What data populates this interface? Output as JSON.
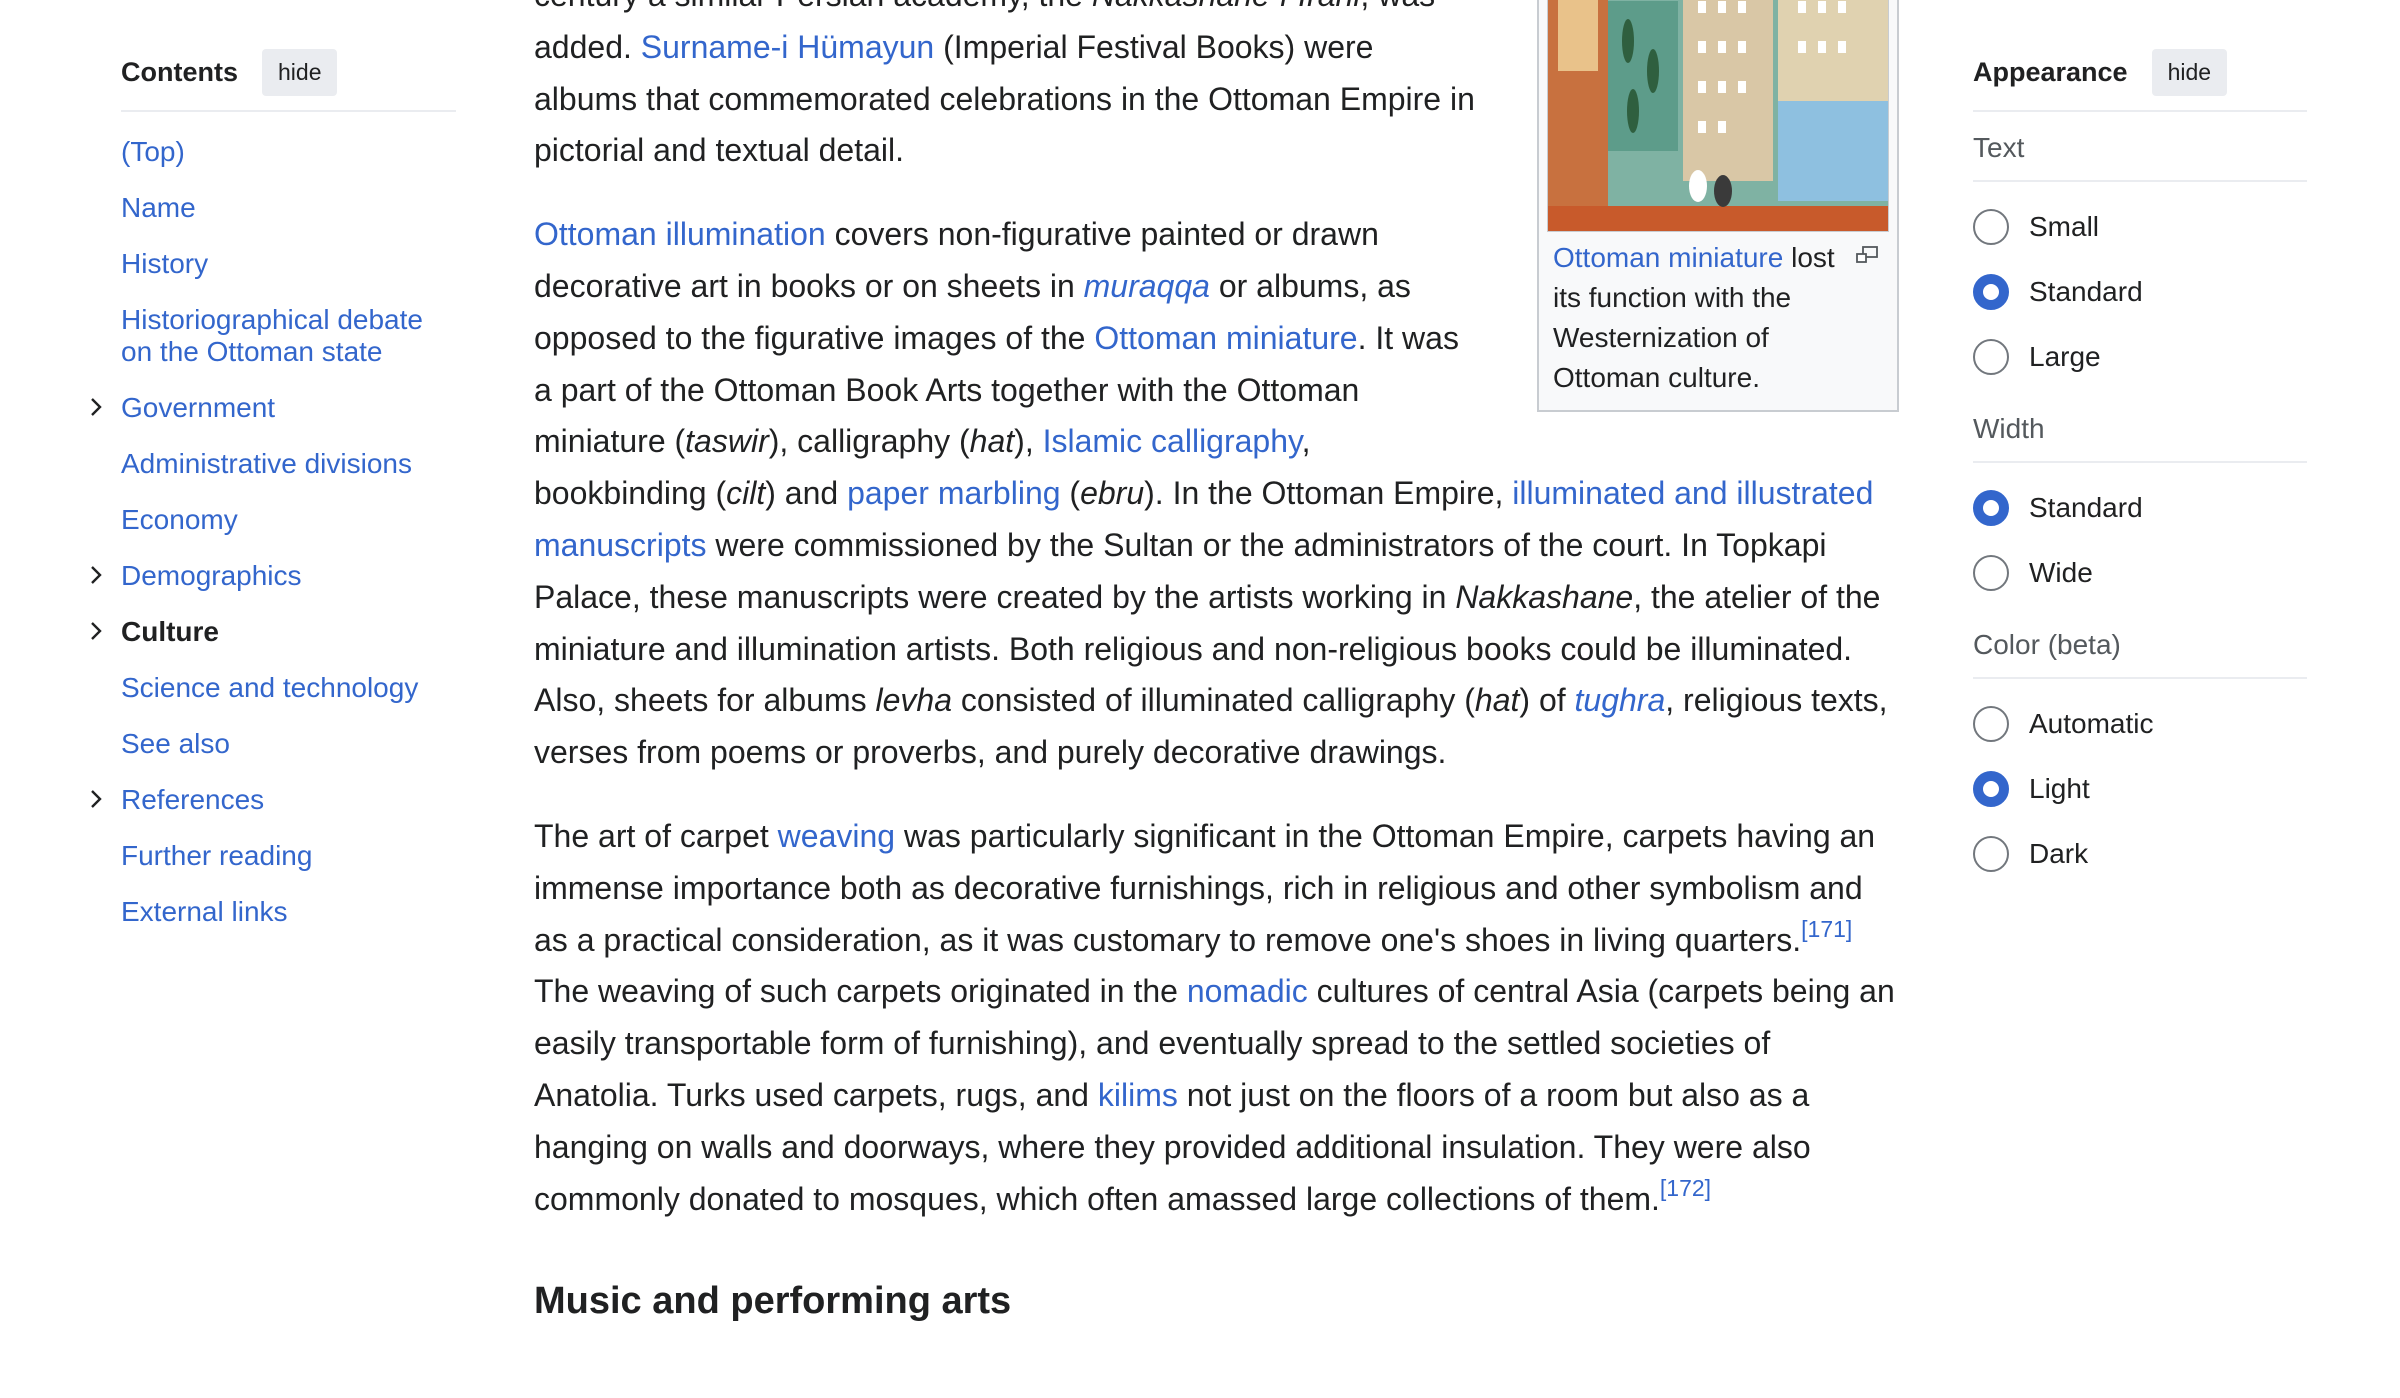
{
  "toc": {
    "title": "Contents",
    "hide_label": "hide",
    "items": [
      {
        "label": "(Top)"
      },
      {
        "label": "Name"
      },
      {
        "label": "History"
      },
      {
        "label": "Historiographical debate on the Ottoman state"
      },
      {
        "label": "Government"
      },
      {
        "label": "Administrative divisions"
      },
      {
        "label": "Economy"
      },
      {
        "label": "Demographics"
      },
      {
        "label": "Culture"
      },
      {
        "label": "Science and technology"
      },
      {
        "label": "See also"
      },
      {
        "label": "References"
      },
      {
        "label": "Further reading"
      },
      {
        "label": "External links"
      }
    ]
  },
  "article": {
    "p1": {
      "t1": "century a similar Persian academy, the ",
      "i1": "Nakkashane-i-Irani",
      "t2": ", was added. ",
      "l1": "Surname-i Hümayun",
      "t3": " (Imperial Festival Books) were albums that commemorated celebrations in the Ottoman Empire in pictorial and textual detail."
    },
    "figure": {
      "caption_link": "Ottoman miniature",
      "caption_rest": " lost its function with the Westernization of Ottoman culture."
    },
    "p2": {
      "l1": "Ottoman illumination",
      "t1": " covers non-figurative painted or drawn decorative art in books or on sheets in ",
      "l2": "muraqqa",
      "t2": " or albums, as opposed to the figurative images of the ",
      "l3": "Ottoman miniature",
      "t3": ". It was a part of the Ottoman Book Arts together with the Ottoman miniature (",
      "i1": "taswir",
      "t4": "), calligraphy (",
      "i2": "hat",
      "t5": "), ",
      "l4": "Islamic calligraphy",
      "t6": ", bookbinding (",
      "i3": "cilt",
      "t7": ") and ",
      "l5": "paper marbling",
      "t8": " (",
      "i4": "ebru",
      "t9": "). In the Ottoman Empire, ",
      "l6": "illuminated and illustrated manuscripts",
      "t10": " were commissioned by the Sultan or the administrators of the court. In Topkapi Palace, these manuscripts were created by the artists working in ",
      "i5": "Nakkashane",
      "t11": ", the atelier of the miniature and illumination artists. Both religious and non-religious books could be illuminated. Also, sheets for albums ",
      "i6": "levha",
      "t12": " consisted of illuminated calligraphy (",
      "i7": "hat",
      "t13": ") of ",
      "l7": "tughra",
      "t14": ", religious texts, verses from poems or proverbs, and purely decorative drawings."
    },
    "p3": {
      "t1": "The art of carpet ",
      "l1": "weaving",
      "t2": " was particularly significant in the Ottoman Empire, carpets having an immense importance both as decorative furnishings, rich in religious and other symbolism and as a practical consideration, as it was customary to remove one's shoes in living quarters.",
      "ref1": "[171]",
      "t3": " The weaving of such carpets originated in the ",
      "l2": "nomadic",
      "t4": " cultures of central Asia (carpets being an easily transportable form of furnishing), and eventually spread to the settled societies of Anatolia. Turks used carpets, rugs, and ",
      "l3": "kilims",
      "t5": " not just on the floors of a room but also as a hanging on walls and doorways, where they provided additional insulation. They were also commonly donated to mosques, which often amassed large collections of them.",
      "ref2": "[172]"
    },
    "h2": "Music and performing arts"
  },
  "appearance": {
    "title": "Appearance",
    "hide_label": "hide",
    "text_label": "Text",
    "text_options": [
      "Small",
      "Standard",
      "Large"
    ],
    "text_selected": "Standard",
    "width_label": "Width",
    "width_options": [
      "Standard",
      "Wide"
    ],
    "width_selected": "Standard",
    "color_label": "Color (beta)",
    "color_options": [
      "Automatic",
      "Light",
      "Dark"
    ],
    "color_selected": "Light",
    "accent_color": "#3366cc"
  }
}
